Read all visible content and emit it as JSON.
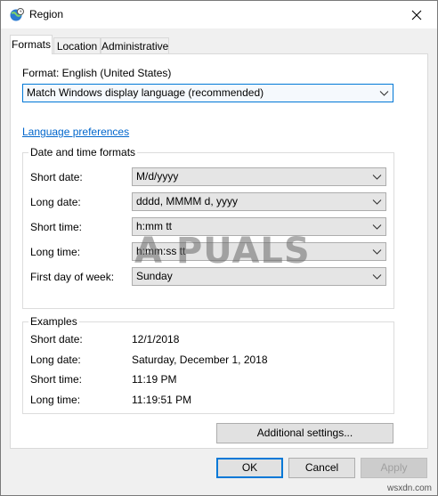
{
  "window": {
    "title": "Region"
  },
  "tabs": [
    {
      "label": "Formats",
      "active": true
    },
    {
      "label": "Location",
      "active": false
    },
    {
      "label": "Administrative",
      "active": false
    }
  ],
  "format": {
    "label": "Format: English (United States)",
    "selected": "Match Windows display language (recommended)"
  },
  "language_preferences_link": "Language preferences",
  "date_time_formats": {
    "title": "Date and time formats",
    "rows": [
      {
        "label": "Short date:",
        "value": "M/d/yyyy"
      },
      {
        "label": "Long date:",
        "value": "dddd, MMMM d, yyyy"
      },
      {
        "label": "Short time:",
        "value": "h:mm tt"
      },
      {
        "label": "Long time:",
        "value": "h:mm:ss tt"
      },
      {
        "label": "First day of week:",
        "value": "Sunday"
      }
    ]
  },
  "examples": {
    "title": "Examples",
    "rows": [
      {
        "label": "Short date:",
        "value": "12/1/2018"
      },
      {
        "label": "Long date:",
        "value": "Saturday, December 1, 2018"
      },
      {
        "label": "Short time:",
        "value": "11:19 PM"
      },
      {
        "label": "Long time:",
        "value": "11:19:51 PM"
      }
    ]
  },
  "additional_settings_label": "Additional settings...",
  "buttons": {
    "ok": "OK",
    "cancel": "Cancel",
    "apply": "Apply"
  },
  "watermark": "A PUALS",
  "site_mark": "wsxdn.com",
  "colors": {
    "accent": "#0078d7",
    "link": "#0066cc"
  }
}
